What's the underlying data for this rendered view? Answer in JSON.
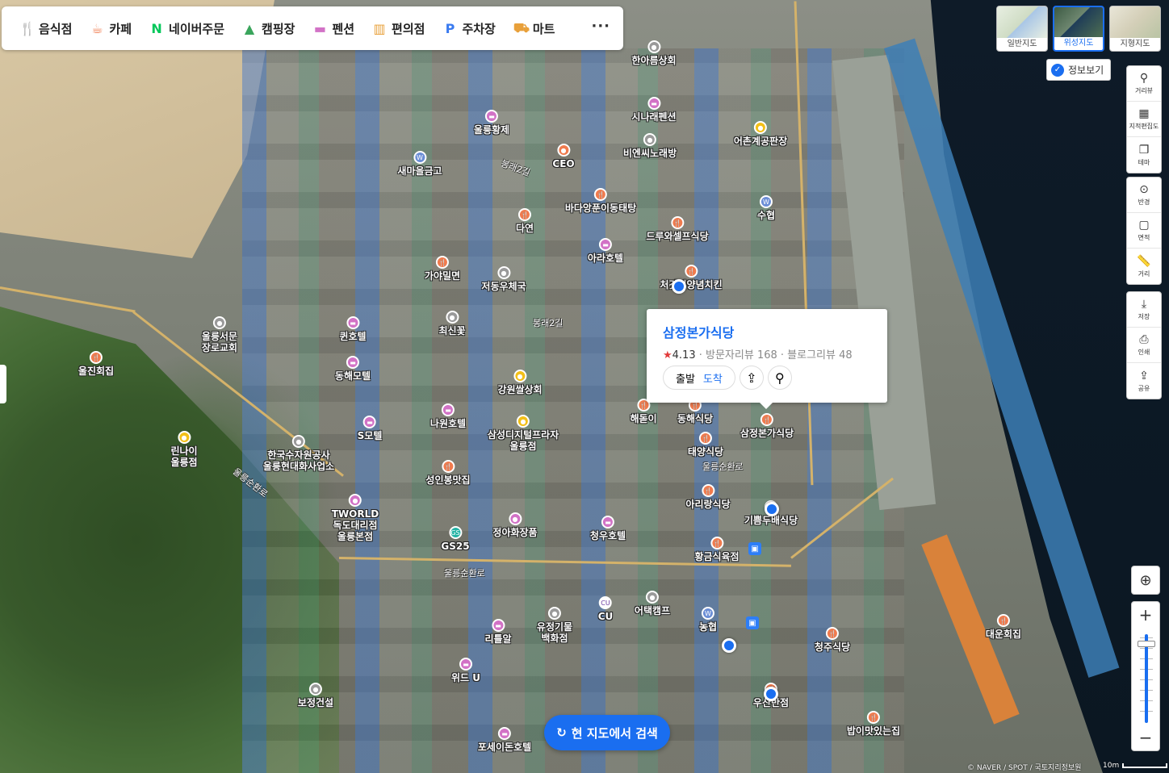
{
  "categories": [
    {
      "icon": "fork-knife-icon",
      "glyph": "🍴",
      "label": "음식점",
      "color": "#f07b4e"
    },
    {
      "icon": "cup-icon",
      "glyph": "☕",
      "label": "카페",
      "color": "#f07b4e"
    },
    {
      "icon": "naver-n-icon",
      "glyph": "N",
      "label": "네이버주문",
      "color": "#03c75a"
    },
    {
      "icon": "tent-icon",
      "glyph": "▲",
      "label": "캠핑장",
      "color": "#3aa55c"
    },
    {
      "icon": "bed-icon",
      "glyph": "▬",
      "label": "펜션",
      "color": "#d272c6"
    },
    {
      "icon": "store-icon",
      "glyph": "▥",
      "label": "편의점",
      "color": "#e8a03a"
    },
    {
      "icon": "parking-icon",
      "glyph": "P",
      "label": "주차장",
      "color": "#3a7bf0"
    },
    {
      "icon": "cart-icon",
      "glyph": "⛟",
      "label": "마트",
      "color": "#e8a03a"
    }
  ],
  "more_label": "···",
  "map_types": [
    {
      "label": "일반지도",
      "selected": false
    },
    {
      "label": "위성지도",
      "selected": true
    },
    {
      "label": "지형지도",
      "selected": false
    }
  ],
  "info_toggle": "정보보기",
  "tools_top": [
    {
      "icon": "pin-icon",
      "glyph": "⚲",
      "label": "거리뷰"
    },
    {
      "icon": "cadastral-icon",
      "glyph": "▦",
      "label": "지적편집도"
    },
    {
      "icon": "theme-icon",
      "glyph": "❐",
      "label": "테마"
    }
  ],
  "tools_mid": [
    {
      "icon": "radius-icon",
      "glyph": "⊙",
      "label": "반경"
    },
    {
      "icon": "area-icon",
      "glyph": "▢",
      "label": "면적"
    },
    {
      "icon": "ruler-icon",
      "glyph": "📏",
      "label": "거리"
    }
  ],
  "tools_bottom": [
    {
      "icon": "save-icon",
      "glyph": "⤓",
      "label": "저장"
    },
    {
      "icon": "print-icon",
      "glyph": "⎙",
      "label": "인쇄"
    },
    {
      "icon": "share-icon",
      "glyph": "⇪",
      "label": "공유"
    }
  ],
  "popup": {
    "name": "삼정본가식당",
    "rating": "4.13",
    "visitor_reviews": "방문자리뷰 168",
    "blog_reviews": "블로그리뷰 48",
    "depart": "출발",
    "arrive": "도착"
  },
  "search_button": "현 지도에서 검색",
  "copyright": "© NAVER / SPOT / 국토지리정보원",
  "scale_label": "10m",
  "pois": [
    {
      "label": "한아름상회",
      "type": "gray",
      "glyph": "●"
    },
    {
      "label": "시나래펜션",
      "type": "stay",
      "glyph": "▬"
    },
    {
      "label": "비엔씨노래방",
      "type": "gray",
      "glyph": "●"
    },
    {
      "label": "어촌계공판장",
      "type": "shop",
      "glyph": "●"
    },
    {
      "label": "울릉황제",
      "type": "stay",
      "glyph": "▬"
    },
    {
      "label": "CEO",
      "type": "food",
      "glyph": "●"
    },
    {
      "label": "새마을금고",
      "type": "bank",
      "glyph": "W"
    },
    {
      "label": "바다앙푼이동태탕",
      "type": "food",
      "glyph": "🍴"
    },
    {
      "label": "수협",
      "type": "bank",
      "glyph": "W"
    },
    {
      "label": "다연",
      "type": "food",
      "glyph": "🍴"
    },
    {
      "label": "드루와셀프식당",
      "type": "food",
      "glyph": "🍴"
    },
    {
      "label": "아라호텔",
      "type": "stay",
      "glyph": "▬"
    },
    {
      "label": "가야밀면",
      "type": "food",
      "glyph": "🍴"
    },
    {
      "label": "저동우체국",
      "type": "gray",
      "glyph": "●"
    },
    {
      "label": "처갓집양념치킨",
      "type": "food",
      "glyph": "🍴"
    },
    {
      "label": "최신꽃",
      "type": "gray",
      "glyph": "●"
    },
    {
      "label": "퀸호텔",
      "type": "stay",
      "glyph": "▬"
    },
    {
      "label": "울릉서문\n장로교회",
      "type": "gray",
      "glyph": "●"
    },
    {
      "label": "울진회집",
      "type": "food",
      "glyph": "🍴"
    },
    {
      "label": "동해모텔",
      "type": "stay",
      "glyph": "▬"
    },
    {
      "label": "강원쌀상회",
      "type": "shop",
      "glyph": "●"
    },
    {
      "label": "해돋이",
      "type": "food",
      "glyph": "🍴"
    },
    {
      "label": "동해식당",
      "type": "food",
      "glyph": "🍴"
    },
    {
      "label": "삼정본가식당",
      "type": "food",
      "glyph": "🍴"
    },
    {
      "label": "나원호텔",
      "type": "stay",
      "glyph": "▬"
    },
    {
      "label": "S모텔",
      "type": "stay",
      "glyph": "▬"
    },
    {
      "label": "삼성디지털프라자\n울릉점",
      "type": "shop",
      "glyph": "●"
    },
    {
      "label": "태양식당",
      "type": "food",
      "glyph": "🍴"
    },
    {
      "label": "린나이\n울릉점",
      "type": "shop",
      "glyph": "●"
    },
    {
      "label": "한국수자원공사\n울릉현대화사업소",
      "type": "gray",
      "glyph": "●"
    },
    {
      "label": "성인봉맛집",
      "type": "food",
      "glyph": "🍴"
    },
    {
      "label": "아리랑식당",
      "type": "food",
      "glyph": "🍴"
    },
    {
      "label": "TWORLD\n독도대리점\n울릉본점",
      "type": "stay",
      "glyph": "●"
    },
    {
      "label": "기쁨두배식당",
      "type": "food",
      "glyph": "🍴"
    },
    {
      "label": "GS25",
      "type": "gs",
      "glyph": "GS"
    },
    {
      "label": "정아화장품",
      "type": "stay",
      "glyph": "●"
    },
    {
      "label": "청우호텔",
      "type": "stay",
      "glyph": "▬"
    },
    {
      "label": "황금식육점",
      "type": "food",
      "glyph": "🍴"
    },
    {
      "label": "어택캠프",
      "type": "gray",
      "glyph": "●"
    },
    {
      "label": "농협",
      "type": "bank",
      "glyph": "W"
    },
    {
      "label": "CU",
      "type": "cu",
      "glyph": "CU"
    },
    {
      "label": "리틀알",
      "type": "stay",
      "glyph": "▬"
    },
    {
      "label": "유정기물\n백화점",
      "type": "gray",
      "glyph": "●"
    },
    {
      "label": "청주식당",
      "type": "food",
      "glyph": "🍴"
    },
    {
      "label": "대운회집",
      "type": "food",
      "glyph": "🍴"
    },
    {
      "label": "위드 U",
      "type": "stay",
      "glyph": "▬"
    },
    {
      "label": "우산반점",
      "type": "food",
      "glyph": "🍴"
    },
    {
      "label": "보정건설",
      "type": "gray",
      "glyph": "●"
    },
    {
      "label": "밥이맛있는집",
      "type": "food",
      "glyph": "🍴"
    },
    {
      "label": "포세이돈호텔",
      "type": "stay",
      "glyph": "▬"
    }
  ],
  "streets": [
    "울릉순환로",
    "울릉순환로",
    "봉래2길",
    "봉래2길",
    "울릉순환로"
  ]
}
